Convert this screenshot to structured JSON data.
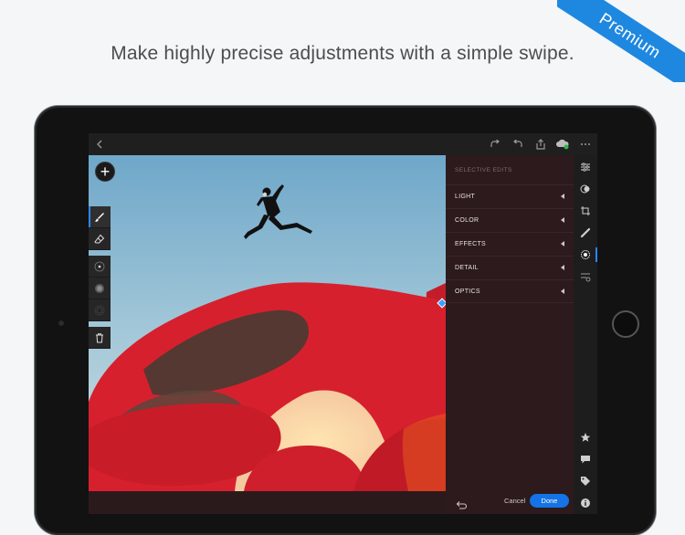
{
  "headline": "Make highly precise adjustments with a simple swipe.",
  "ribbon": {
    "label": "Premium",
    "color": "#1e88e0"
  },
  "accent_color": "#1473e6",
  "topbar": {
    "icons": [
      "back-arrow-icon",
      "redo-icon",
      "undo-icon",
      "share-icon",
      "cloud-sync-icon",
      "more-icon"
    ]
  },
  "tools": [
    "brush-icon",
    "eraser-icon",
    "radial-gradient-icon",
    "linear-gradient-icon",
    "feather-icon",
    "trash-icon"
  ],
  "panel": {
    "title": "SELECTIVE EDITS",
    "items": [
      {
        "label": "LIGHT"
      },
      {
        "label": "COLOR"
      },
      {
        "label": "EFFECTS"
      },
      {
        "label": "DETAIL"
      },
      {
        "label": "OPTICS"
      }
    ],
    "cancel_label": "Cancel",
    "done_label": "Done"
  },
  "rightbar": {
    "icons": [
      "sliders-icon",
      "presets-icon",
      "crop-icon",
      "healing-icon",
      "selective-icon",
      "versions-icon",
      "star-icon",
      "comment-icon",
      "tag-icon",
      "info-icon"
    ]
  }
}
